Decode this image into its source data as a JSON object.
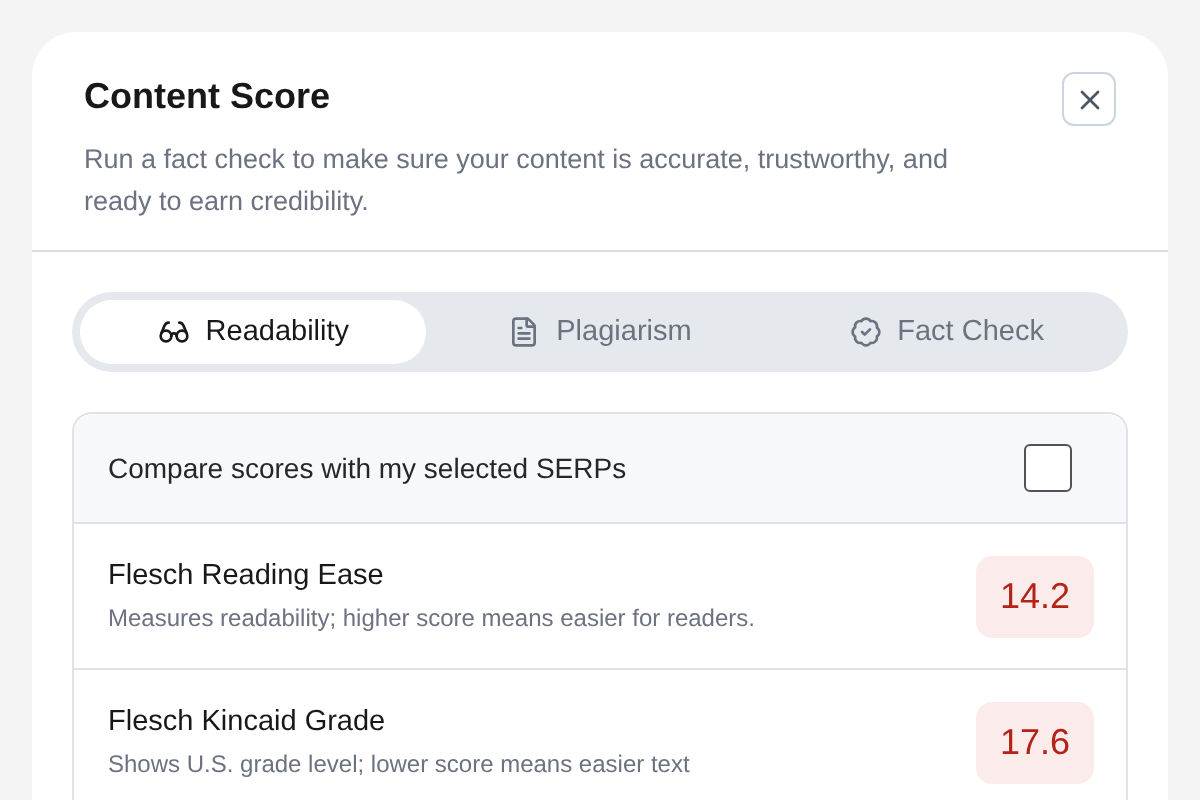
{
  "dialog": {
    "title": "Content Score",
    "description": "Run a fact check to make sure your content is accurate, trustworthy, and ready to earn credibility."
  },
  "tabs": [
    {
      "label": "Readability",
      "kind": "glasses",
      "selected": true
    },
    {
      "label": "Plagiarism",
      "kind": "document",
      "selected": false
    },
    {
      "label": "Fact Check",
      "kind": "badge",
      "selected": false
    }
  ],
  "compare": {
    "label": "Compare scores with my selected SERPs",
    "checked": false
  },
  "metrics": [
    {
      "name": "Flesch Reading Ease",
      "description": "Measures readability; higher score means easier for readers.",
      "score": "14.2"
    },
    {
      "name": "Flesch Kincaid Grade",
      "description": "Shows U.S. grade level; lower score means easier text",
      "score": "17.6"
    }
  ]
}
